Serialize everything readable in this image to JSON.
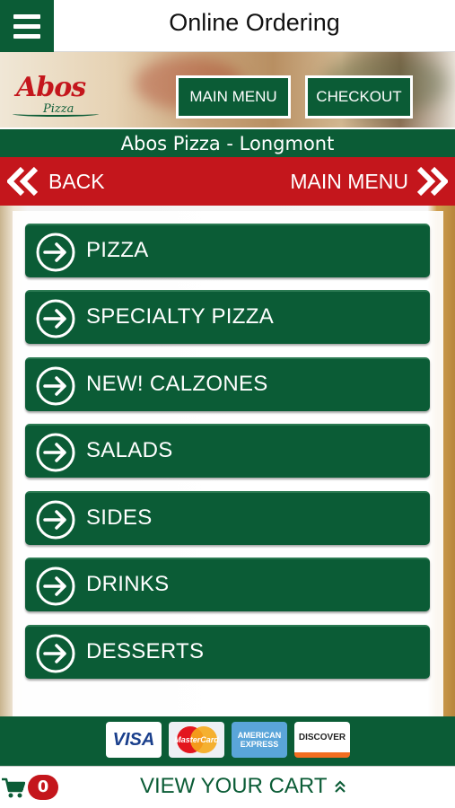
{
  "topbar": {
    "title": "Online Ordering",
    "menu_icon": "hamburger-icon"
  },
  "header": {
    "logo_text": "Abos",
    "logo_subtext": "Pizza",
    "main_menu_label": "MAIN MENU",
    "checkout_label": "CHECKOUT"
  },
  "location": {
    "name": "Abos Pizza - Longmont"
  },
  "nav": {
    "back_label": "BACK",
    "main_menu_label": "MAIN MENU"
  },
  "categories": [
    {
      "label": "PIZZA"
    },
    {
      "label": "SPECIALTY PIZZA"
    },
    {
      "label": "NEW! CALZONES"
    },
    {
      "label": "SALADS"
    },
    {
      "label": "SIDES"
    },
    {
      "label": "DRINKS"
    },
    {
      "label": "DESSERTS"
    }
  ],
  "payments": {
    "visa": "VISA",
    "mastercard": "MasterCard",
    "amex_line1": "AMERICAN",
    "amex_line2": "EXPRESS",
    "discover": "DISCOVER"
  },
  "cart": {
    "count": "0",
    "view_label": "VIEW YOUR CART"
  },
  "colors": {
    "green": "#0b5c36",
    "red": "#c4161c"
  }
}
